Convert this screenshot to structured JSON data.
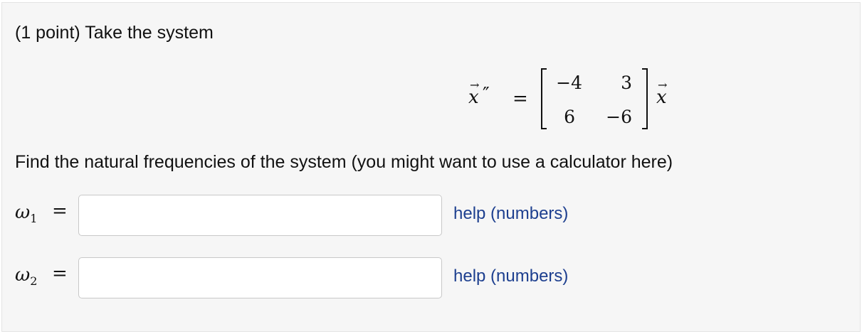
{
  "problem": {
    "intro": "(1 point) Take the system",
    "equation": {
      "lhs_var": "x",
      "lhs_prime": "″",
      "arrow": "→",
      "equals": "=",
      "matrix": [
        [
          "−4",
          "3"
        ],
        [
          "6",
          "−6"
        ]
      ],
      "rhs_var": "x"
    },
    "question": "Find the natural frequencies of the system (you might want to use a calculator here)",
    "answers": [
      {
        "symbol": "ω",
        "subscript": "1",
        "equals": "=",
        "value": "",
        "help": "help (numbers)"
      },
      {
        "symbol": "ω",
        "subscript": "2",
        "equals": "=",
        "value": "",
        "help": "help (numbers)"
      }
    ]
  }
}
